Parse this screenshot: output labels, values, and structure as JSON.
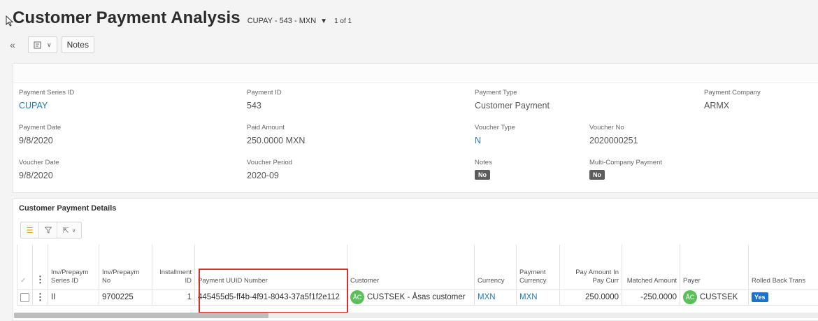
{
  "header": {
    "title": "Customer Payment Analysis",
    "record_key": "CUPAY - 543 - MXN",
    "record_count": "1 of 1"
  },
  "toolbar": {
    "collapse_icon": "double-chevron-left-icon",
    "layout_icon": "page-layout-icon",
    "notes_label": "Notes"
  },
  "fields": {
    "payment_series_id": {
      "label": "Payment Series ID",
      "value": "CUPAY"
    },
    "payment_id": {
      "label": "Payment ID",
      "value": "543"
    },
    "payment_type": {
      "label": "Payment Type",
      "value": "Customer Payment"
    },
    "payment_company": {
      "label": "Payment Company",
      "value": "ARMX"
    },
    "payment_date": {
      "label": "Payment Date",
      "value": "9/8/2020"
    },
    "paid_amount": {
      "label": "Paid Amount",
      "value": "250.0000 MXN"
    },
    "voucher_type": {
      "label": "Voucher Type",
      "value": "N"
    },
    "voucher_no": {
      "label": "Voucher No",
      "value": "2020000251"
    },
    "voucher_date": {
      "label": "Voucher Date",
      "value": "9/8/2020"
    },
    "voucher_period": {
      "label": "Voucher Period",
      "value": "2020-09"
    },
    "notes": {
      "label": "Notes",
      "value": "No"
    },
    "multi_company_payment": {
      "label": "Multi-Company Payment",
      "value": "No"
    }
  },
  "details": {
    "title": "Customer Payment Details",
    "columns": [
      "Inv/Prepaym Series ID",
      "Inv/Prepaym No",
      "Installment ID",
      "Payment UUID Number",
      "Customer",
      "Currency",
      "Payment Currency",
      "Pay Amount In Pay Curr",
      "Matched Amount",
      "Payer",
      "Rolled Back Trans"
    ],
    "rows": [
      {
        "series_id": "II",
        "inv_no": "9700225",
        "installment_id": "1",
        "uuid": "445455d5-ff4b-4f91-8043-37a5f1f2e112",
        "customer_avatar": "ÅC",
        "customer": "CUSTSEK - Åsas customer",
        "currency": "MXN",
        "payment_currency": "MXN",
        "pay_amount": "250.0000",
        "matched_amount": "-250.0000",
        "payer_avatar": "ÅC",
        "payer": "CUSTSEK",
        "rolled_back": "Yes"
      }
    ]
  },
  "colors": {
    "link": "#1f7ab8",
    "highlight": "#d82e2e",
    "avatar": "#5cbf5c",
    "yes_badge": "#1a73c8"
  }
}
